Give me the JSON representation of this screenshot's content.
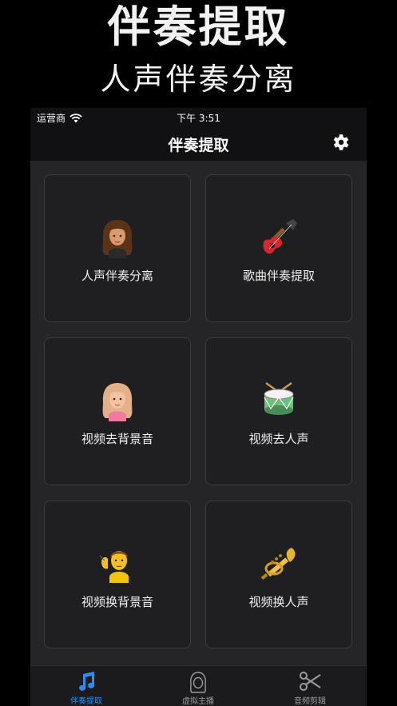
{
  "promo": {
    "title": "伴奏提取",
    "subtitle": "人声伴奏分离"
  },
  "status_bar": {
    "carrier": "运营商",
    "time": "下午 3:51"
  },
  "nav": {
    "title": "伴奏提取",
    "settings_icon": "gear-icon"
  },
  "features": [
    {
      "label": "人声伴奏分离",
      "icon": "woman-curly-hair-icon"
    },
    {
      "label": "歌曲伴奏提取",
      "icon": "guitar-icon"
    },
    {
      "label": "视频去背景音",
      "icon": "woman-blonde-icon"
    },
    {
      "label": "视频去人声",
      "icon": "drum-icon"
    },
    {
      "label": "视频换背景音",
      "icon": "deaf-person-icon"
    },
    {
      "label": "视频换人声",
      "icon": "trumpet-icon"
    }
  ],
  "tabs": [
    {
      "label": "伴奏提取",
      "icon": "music-note-icon",
      "active": true
    },
    {
      "label": "虚拟主播",
      "icon": "avatar-icon",
      "active": false
    },
    {
      "label": "音频剪辑",
      "icon": "scissors-icon",
      "active": false
    }
  ],
  "colors": {
    "accent": "#2d8cf0",
    "background": "#252528",
    "card": "#1f1f22"
  }
}
